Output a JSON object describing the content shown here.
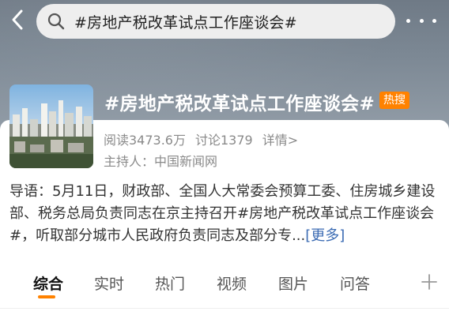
{
  "header": {
    "search_text": "#房地产税改革试点工作座谈会#"
  },
  "topic": {
    "title": "#房地产税改革试点工作座谈会#",
    "badge": "热搜",
    "reads": "阅读3473.6万",
    "discussions": "讨论1379",
    "details": "详情>",
    "host": "主持人：中国新闻网"
  },
  "intro": {
    "text": "导语：5月11日，财政部、全国人大常委会预算工委、住房城乡建设部、税务总局负责同志在京主持召开#房地产税改革试点工作座谈会#，听取部分城市人民政府负责同志及部分专...",
    "more": "[更多]"
  },
  "tabs": [
    {
      "label": "综合"
    },
    {
      "label": "实时"
    },
    {
      "label": "热门"
    },
    {
      "label": "视频"
    },
    {
      "label": "图片"
    },
    {
      "label": "问答"
    }
  ],
  "icons": {
    "back": "chevron-left-icon",
    "search": "search-icon",
    "more": "more-dots-icon",
    "plus": "plus-icon"
  },
  "colors": {
    "accent": "#ff8200",
    "link": "#3b6bb3"
  }
}
